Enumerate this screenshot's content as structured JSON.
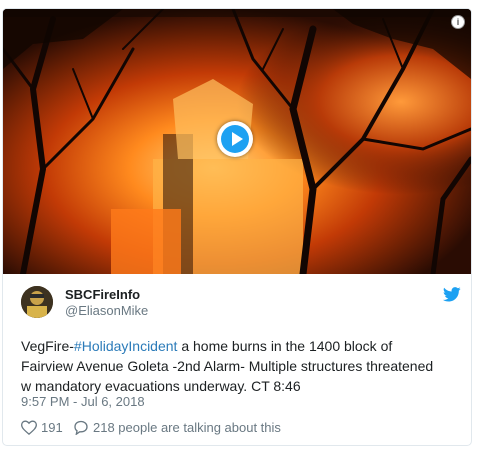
{
  "tweet": {
    "display_name": "SBCFireInfo",
    "handle": "@EliasonMike",
    "text_prefix": "VegFire-",
    "hashtag": "#HolidayIncident",
    "text_line1_rest": " a home burns in the 1400 block of",
    "text_line2": "Fairview Avenue Goleta -2nd Alarm- Multiple structures threatened",
    "text_line3": "w mandatory evacuations underway. CT 8:46",
    "timestamp": "9:57 PM - Jul 6, 2018",
    "likes": "191",
    "talking": "218 people are talking about this"
  },
  "icons": {
    "play": "play-icon",
    "info": "info-icon",
    "bird": "twitter-bird-icon",
    "heart": "heart-icon",
    "reply": "reply-bubble-icon"
  },
  "colors": {
    "accent": "#1da1f2",
    "link": "#2b7bb9",
    "muted": "#697882"
  }
}
